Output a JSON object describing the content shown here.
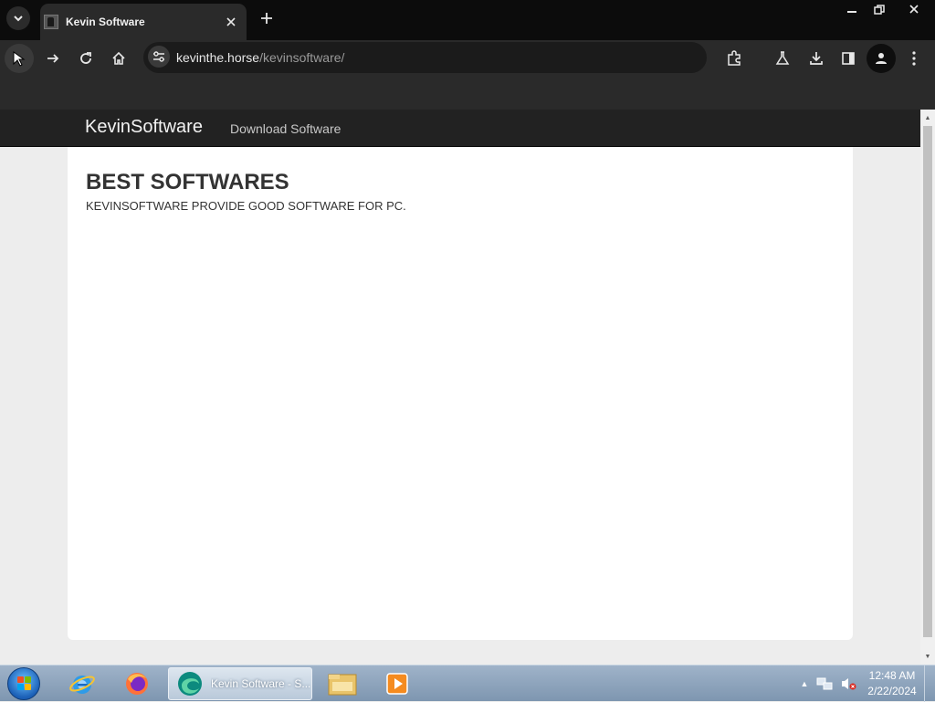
{
  "browser": {
    "tab_title": "Kevin Software",
    "url_domain": "kevinthe.horse",
    "url_path": "/kevinsoftware/"
  },
  "site": {
    "brand": "KevinSoftware",
    "nav_link": "Download Software",
    "hero_title": "BEST SOFTWARES",
    "hero_subtitle": "KEVINSOFTWARE PROVIDE GOOD SOFTWARE FOR PC."
  },
  "taskbar": {
    "active_window_label": "Kevin Software - S...",
    "time": "12:48 AM",
    "date": "2/22/2024"
  },
  "colors": {
    "navbar_bg": "#222222",
    "page_bg": "#ededed",
    "browser_frame": "#2a2a2a"
  },
  "icons": [
    "tab-search-icon",
    "close-icon",
    "plus-icon",
    "minimize-icon",
    "restore-icon",
    "back-icon",
    "forward-icon",
    "reload-icon",
    "home-icon",
    "site-settings-icon",
    "star-icon",
    "extensions-icon",
    "labs-icon",
    "download-icon",
    "side-panel-icon",
    "profile-icon",
    "menu-icon",
    "start-icon",
    "ie-icon",
    "firefox-icon",
    "edge-icon",
    "explorer-icon",
    "media-player-icon",
    "network-icon",
    "volume-muted-icon"
  ]
}
